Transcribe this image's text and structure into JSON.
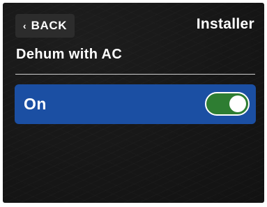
{
  "header": {
    "back_chevron": "‹",
    "back_label": "BACK",
    "title": "Installer"
  },
  "setting": {
    "title": "Dehum with AC",
    "option_label": "On",
    "toggle_on": true
  },
  "colors": {
    "background": "#161616",
    "back_button": "#2c2c2c",
    "selected_row": "#1b4fa3",
    "toggle_on": "#2e7d32",
    "text": "#ffffff"
  }
}
